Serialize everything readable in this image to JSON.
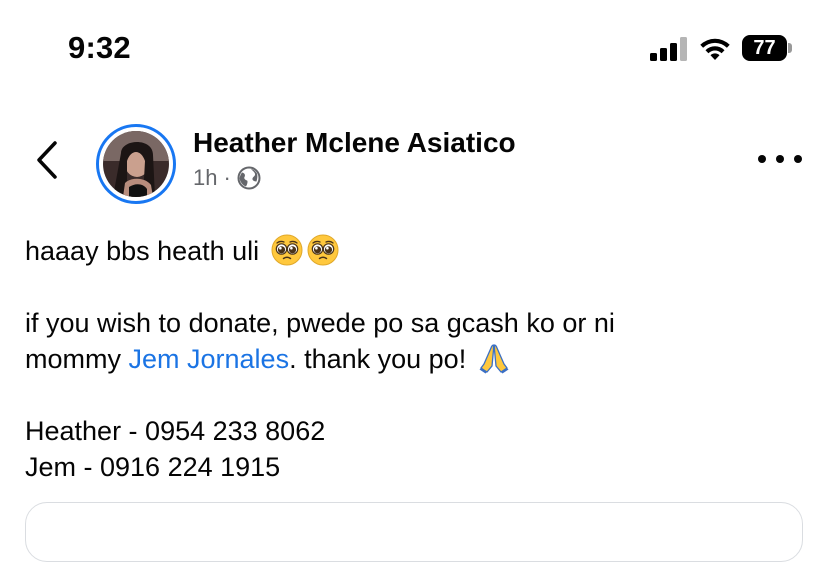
{
  "status_bar": {
    "time": "9:32",
    "battery_level": "77",
    "icons": [
      "signal-icon",
      "wifi-icon",
      "battery-icon"
    ]
  },
  "post": {
    "author": "Heather Mclene Asiatico",
    "time_ago": "1h",
    "separator": "·",
    "privacy_icon": "globe-icon",
    "line1_text": "haaay bbs heath uli",
    "line1_emojis": [
      "pleading-face",
      "pleading-face"
    ],
    "line2_text": "if you wish to donate, pwede po sa gcash ko or ni",
    "line3_prefix": "mommy ",
    "mention": "Jem Jornales",
    "line3_suffix": ". thank you po! ",
    "line3_emoji": "folded-hands",
    "contact1": "Heather - 0954 233 8062",
    "contact2": "Jem - 0916 224 1915"
  },
  "colors": {
    "accent": "#1877f2",
    "mention": "#1b74e4",
    "meta": "#65676b",
    "text": "#050505"
  }
}
